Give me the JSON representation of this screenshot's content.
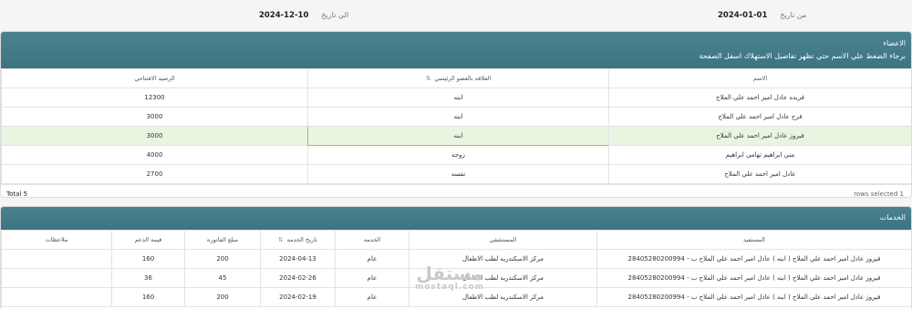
{
  "filters": {
    "from_label": "من تاريخ",
    "from_value": "2024-01-01",
    "to_label": "الي تاريخ",
    "to_value": "2024-12-10"
  },
  "members_panel": {
    "title": "الاعضاء",
    "hint": "برجاء الضغط علي الاسم حتي تظهر تفاصيل الاستهلاك اسفل الصفحة",
    "columns": {
      "name": "الاسم",
      "relation": "العلاقه بالعضو الرئيسي",
      "balance": "الرصيد الافتتاحي"
    },
    "rows": [
      {
        "name": "فريده عادل امير احمد علي الملاح",
        "relation": "ابنه",
        "balance": "12300"
      },
      {
        "name": "فرح عادل امير احمد علي الملاح",
        "relation": "ابنه",
        "balance": "3000"
      },
      {
        "name": "فيروز عادل امير احمد علي الملاح",
        "relation": "ابنه",
        "balance": "3000"
      },
      {
        "name": "مني ابراهيم تهامي ابراهيم",
        "relation": "زوجه",
        "balance": "4000"
      },
      {
        "name": "عادل امير احمد علي الملاح",
        "relation": "نفسه",
        "balance": "2700"
      }
    ],
    "total": "Total 5",
    "selected": "rows selected 1"
  },
  "services_panel": {
    "title": "الخدمات",
    "columns": {
      "beneficiary": "المستفيد",
      "hospital": "المستشفي",
      "service": "الخدمه",
      "date": "تاريخ الخدمه",
      "invoice": "مبلغ الفاتوره",
      "support": "قيمه الدعم",
      "notes": "ملاحظات"
    },
    "rows": [
      {
        "beneficiary": "فيروز عادل امير احمد علي الملاح ( ابنه ) عادل امير احمد علي الملاح ب - 28405280200994",
        "hospital": "مركز الاسكندريه لطب الاطفال",
        "service": "عام",
        "date": "2024-04-13",
        "invoice": "200",
        "support": "160",
        "notes": ""
      },
      {
        "beneficiary": "فيروز عادل امير احمد علي الملاح ( ابنه ) عادل امير احمد علي الملاح ب - 28405280200994",
        "hospital": "مركز الاسكندريه لطب الاطفال",
        "service": "عام",
        "date": "2024-02-26",
        "invoice": "45",
        "support": "36",
        "notes": ""
      },
      {
        "beneficiary": "فيروز عادل امير احمد علي الملاح ( ابنه ) عادل امير احمد علي الملاح ب - 28405280200994",
        "hospital": "مركز الاسكندريه لطب الاطفال",
        "service": "عام",
        "date": "2024-02-19",
        "invoice": "200",
        "support": "160",
        "notes": ""
      }
    ]
  },
  "watermark": {
    "ar": "مستقل",
    "en": "mostaql.com"
  }
}
